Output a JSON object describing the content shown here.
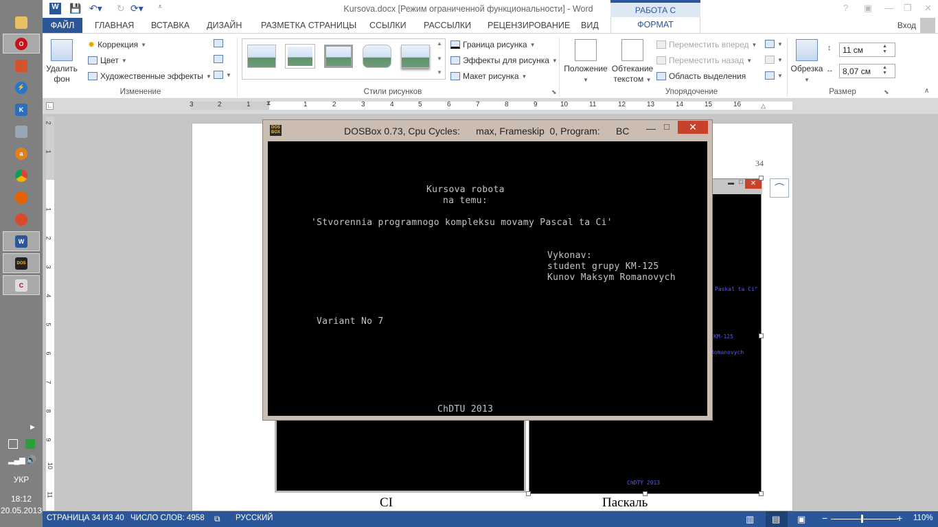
{
  "taskbar": {
    "language": "УКР",
    "time": "18:12",
    "date": "20.05.2013",
    "icons": [
      "explorer-icon",
      "opera-icon",
      "tool-icon",
      "lightning-icon",
      "knf-icon",
      "network-icon",
      "avast-icon",
      "chrome-icon",
      "firefox-icon",
      "app-icon",
      "word-icon",
      "dosbox-icon",
      "pascal-icon"
    ]
  },
  "titlebar": {
    "title": "Kursova.docx [Режим ограниченной функциональности] - Word",
    "context_tab_group": "РАБОТА С РИСУНКАМИ"
  },
  "tabs": {
    "file": "ФАЙЛ",
    "items": [
      "ГЛАВНАЯ",
      "ВСТАВКА",
      "ДИЗАЙН",
      "РАЗМЕТКА СТРАНИЦЫ",
      "ССЫЛКИ",
      "РАССЫЛКИ",
      "РЕЦЕНЗИРОВАНИЕ",
      "ВИД"
    ],
    "format": "ФОРМАТ",
    "login": "Вход"
  },
  "ribbon": {
    "remove_bg_1": "Удалить",
    "remove_bg_2": "фон",
    "correction": "Коррекция",
    "color": "Цвет",
    "artistic": "Художественные эффекты",
    "group_change": "Изменение",
    "border": "Граница рисунка",
    "effects": "Эффекты для рисунка",
    "layout": "Макет рисунка",
    "group_styles": "Стили рисунков",
    "position": "Положение",
    "wrap_1": "Обтекание",
    "wrap_2": "текстом",
    "bring_forward": "Переместить вперед",
    "send_backward": "Переместить назад",
    "selection_pane": "Область выделения",
    "group_arrange": "Упорядочение",
    "crop": "Обрезка",
    "height": "11 см",
    "width": "8,07 см",
    "group_size": "Размер"
  },
  "ruler": {
    "numbers": [
      "3",
      "2",
      "1",
      "1",
      "2",
      "3",
      "4",
      "5",
      "6",
      "7",
      "8",
      "9",
      "10",
      "11",
      "12",
      "13",
      "14",
      "15",
      "16"
    ],
    "vnumbers": [
      "2",
      "1",
      "1",
      "2",
      "3",
      "4",
      "5",
      "6",
      "7",
      "8",
      "9",
      "10",
      "11"
    ]
  },
  "document": {
    "page_number": "34",
    "caption_left": "СІ",
    "caption_right": "Паскаль",
    "thumb_fragments": {
      "line1": "Paskal ta Ci\"",
      "line2": "KM-125",
      "line3": "Romanovych",
      "line4": "ChDTY 2013"
    }
  },
  "dosbox": {
    "title": "DOSBox 0.73, Cpu Cycles:      max, Frameskip  0, Program:      BC",
    "logo": "DOS BOX",
    "screen": {
      "line1": "Kursova robota",
      "line2": "na temu:",
      "line3": "'Stvorennia programnogo kompleksu movamy Pascal ta Ci'",
      "line4": "Vykonav:",
      "line5": "student grupy KM-125",
      "line6": "Kunov Maksym Romanovych",
      "line7": "Variant No 7",
      "line8": "ChDTU 2013"
    }
  },
  "statusbar": {
    "page": "СТРАНИЦА 34 ИЗ 40",
    "words": "ЧИСЛО СЛОВ: 4958",
    "language": "РУССКИЙ",
    "zoom": "110%"
  }
}
